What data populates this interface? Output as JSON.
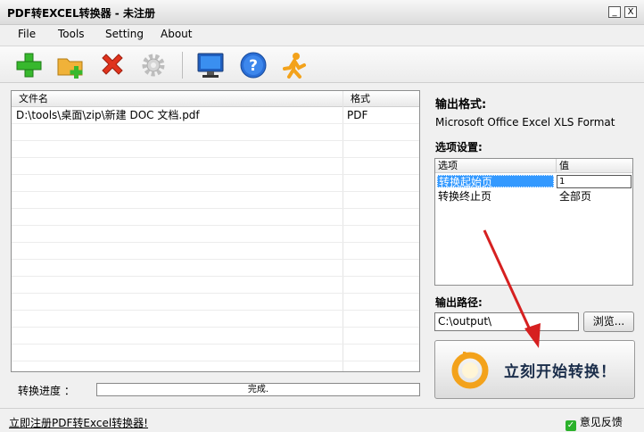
{
  "window": {
    "title": "PDF转EXCEL转换器 - 未注册",
    "min_label": "_",
    "close_label": "X"
  },
  "menu": [
    "File",
    "Tools",
    "Setting",
    "About"
  ],
  "toolbar": {
    "buttons": [
      {
        "icon": "add-file-icon"
      },
      {
        "icon": "add-folder-icon"
      },
      {
        "icon": "delete-icon"
      },
      {
        "icon": "settings-icon"
      },
      {
        "icon": "monitor-icon"
      },
      {
        "icon": "help-icon"
      },
      {
        "icon": "run-icon"
      }
    ]
  },
  "file_list": {
    "columns": [
      "文件名",
      "格式"
    ],
    "rows": [
      {
        "name": "D:\\tools\\桌面\\zip\\新建 DOC 文档.pdf",
        "format": "PDF"
      }
    ]
  },
  "output": {
    "format_label": "输出格式:",
    "format_value": "Microsoft Office Excel XLS Format",
    "options_label": "选项设置:",
    "options_columns": [
      "选项",
      "值"
    ],
    "options": [
      {
        "name": "转换起始页",
        "value": "1",
        "selected": true
      },
      {
        "name": "转换终止页",
        "value": "全部页",
        "selected": false
      }
    ],
    "path_label": "输出路径:",
    "path_value": "C:\\output\\",
    "browse_label": "浏览...",
    "start_label": "立刻开始转换！"
  },
  "progress": {
    "label": "转换进度 ：",
    "text": "完成.",
    "value": 1.0
  },
  "status": {
    "register_link": "立即注册PDF转Excel转换器!",
    "feedback_label": "意见反馈"
  },
  "colors": {
    "selection": "#3399ff",
    "arrow": "#d62020",
    "accent_orange": "#f3a21b"
  }
}
